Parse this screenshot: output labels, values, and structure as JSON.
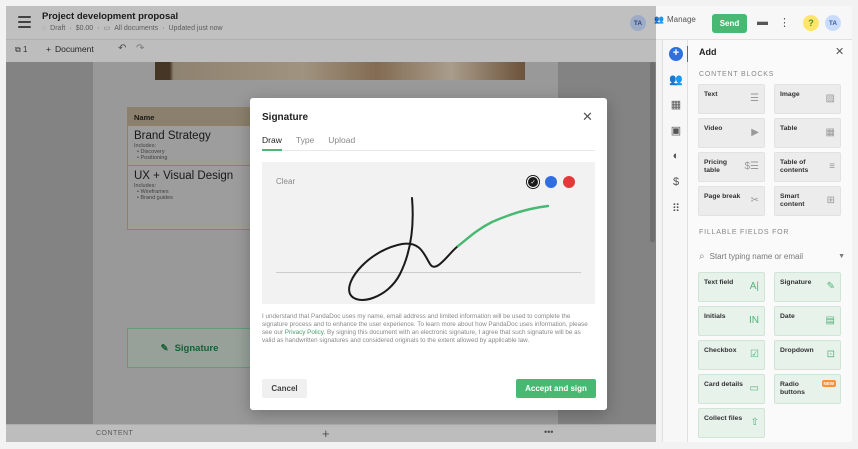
{
  "header": {
    "title": "Project development proposal",
    "status": "Draft",
    "amount": "$0.00",
    "folder": "All documents",
    "updated": "Updated just now",
    "avatar_initials": "TA",
    "manage_label": "Manage",
    "send_label": "Send",
    "help_label": "?"
  },
  "doc_toolbar": {
    "page_count": "1",
    "add_document_label": "Document"
  },
  "document": {
    "table_header": "Name",
    "services": [
      {
        "name": "Brand Strategy",
        "includes": "Includes:",
        "bullets": [
          "Discovery",
          "Positioning"
        ]
      },
      {
        "name": "UX + Visual Design",
        "includes": "Includes:",
        "bullets": [
          "Wireframes",
          "Brand guides"
        ]
      }
    ],
    "signature_field_label": "Signature"
  },
  "footer": {
    "label": "CONTENT",
    "add": "+",
    "more": "•••"
  },
  "modal": {
    "title": "Signature",
    "close": "✕",
    "tabs": [
      "Draw",
      "Type",
      "Upload"
    ],
    "active_tab": "Draw",
    "clear_label": "Clear",
    "colors": [
      "#1a1a1a",
      "#2f6fe0",
      "#e03a3a"
    ],
    "selected_color": "#1a1a1a",
    "legal_before_link": "I understand that PandaDoc uses my name, email address and limited information will be used to complete the signature process and to enhance the user experience. To learn more about how PandaDoc uses information, please see our ",
    "legal_link": "Privacy Policy",
    "legal_after_link": ". By signing this document with an electronic signature, I agree that such signature will be as valid as handwritten signatures and considered originals to the extent allowed by applicable law.",
    "cancel_label": "Cancel",
    "accept_label": "Accept and sign"
  },
  "right_panel": {
    "title": "Add",
    "close": "✕",
    "content_blocks_heading": "CONTENT BLOCKS",
    "content_blocks": [
      {
        "label": "Text",
        "icon": "text-icon"
      },
      {
        "label": "Image",
        "icon": "image-icon"
      },
      {
        "label": "Video",
        "icon": "video-icon"
      },
      {
        "label": "Table",
        "icon": "table-icon"
      },
      {
        "label": "Pricing table",
        "icon": "pricing-table-icon"
      },
      {
        "label": "Table of contents",
        "icon": "toc-icon"
      },
      {
        "label": "Page break",
        "icon": "page-break-icon"
      },
      {
        "label": "Smart content",
        "icon": "smart-content-icon"
      }
    ],
    "fillable_heading": "FILLABLE FIELDS FOR",
    "search_placeholder": "Start typing name or email",
    "fillable_fields": [
      {
        "label": "Text field",
        "icon": "text-field-icon"
      },
      {
        "label": "Signature",
        "icon": "signature-icon"
      },
      {
        "label": "Initials",
        "icon": "initials-icon"
      },
      {
        "label": "Date",
        "icon": "date-icon"
      },
      {
        "label": "Checkbox",
        "icon": "checkbox-icon"
      },
      {
        "label": "Dropdown",
        "icon": "dropdown-icon"
      },
      {
        "label": "Card details",
        "icon": "card-icon"
      },
      {
        "label": "Radio buttons",
        "icon": "radio-icon",
        "badge": "NEW"
      },
      {
        "label": "Collect files",
        "icon": "upload-icon"
      }
    ]
  },
  "colors": {
    "brand_green": "#47b972",
    "accent_blue": "#2f6fe0"
  }
}
